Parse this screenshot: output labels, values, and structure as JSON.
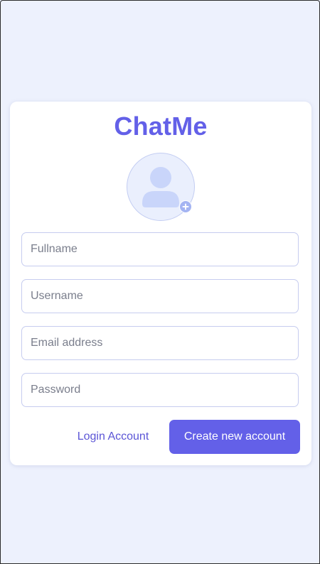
{
  "app": {
    "brand": "ChatMe"
  },
  "avatar": {
    "icon": "user-avatar-icon",
    "badge_icon": "add-photo-plus-icon"
  },
  "form": {
    "fullname_placeholder": "Fullname",
    "username_placeholder": "Username",
    "email_placeholder": "Email address",
    "password_placeholder": "Password",
    "fullname_value": "",
    "username_value": "",
    "email_value": "",
    "password_value": ""
  },
  "actions": {
    "login_label": "Login Account",
    "create_label": "Create new account"
  },
  "colors": {
    "accent": "#6360e8",
    "background": "#edf1fd",
    "card": "#ffffff",
    "field_border": "#c6ccef",
    "avatar_fill": "#c9d5fa"
  }
}
